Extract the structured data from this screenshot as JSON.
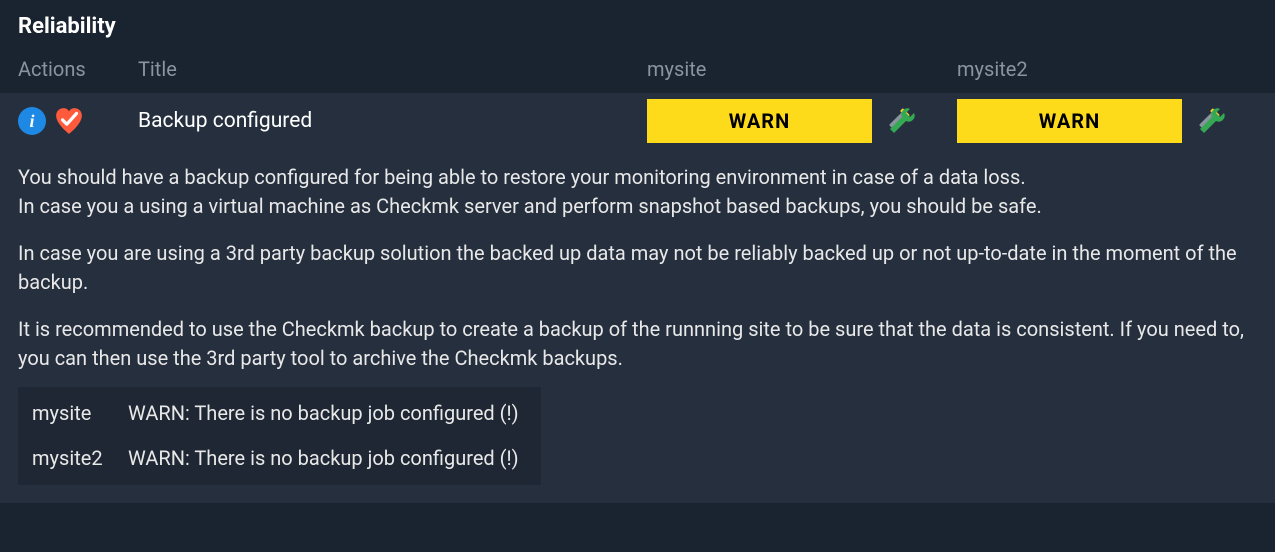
{
  "section_title": "Reliability",
  "columns": {
    "actions": "Actions",
    "title": "Title",
    "site1": "mysite",
    "site2": "mysite2"
  },
  "check": {
    "title": "Backup configured",
    "status1": "WARN",
    "status2": "WARN"
  },
  "desc": {
    "p1a": "You should have a backup configured for being able to restore your monitoring environment in case of a data loss.",
    "p1b": "In case you a using a virtual machine as Checkmk server and perform snapshot based backups, you should be safe.",
    "p2": "In case you are using a 3rd party backup solution the backed up data may not be reliably backed up or not up-to-date in the moment of the backup.",
    "p3": "It is recommended to use the Checkmk backup to create a backup of the runnning site to be sure that the data is consistent. If you need to, you can then use the 3rd party tool to archive the Checkmk backups."
  },
  "site_details": [
    {
      "name": "mysite",
      "msg": "WARN: There is no backup job configured (!)"
    },
    {
      "name": "mysite2",
      "msg": "WARN: There is no backup job configured (!)"
    }
  ]
}
